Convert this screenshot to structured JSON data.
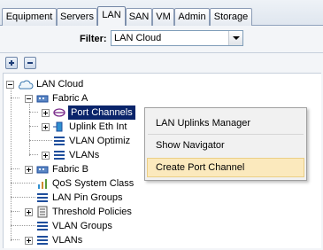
{
  "tabs": [
    {
      "label": "Equipment",
      "active": false
    },
    {
      "label": "Servers",
      "active": false
    },
    {
      "label": "LAN",
      "active": true
    },
    {
      "label": "SAN",
      "active": false
    },
    {
      "label": "VM",
      "active": false
    },
    {
      "label": "Admin",
      "active": false
    },
    {
      "label": "Storage",
      "active": false
    }
  ],
  "filter": {
    "label": "Filter:",
    "value": "LAN Cloud"
  },
  "toolbar": {
    "expand_icon": "plus-icon",
    "collapse_icon": "minus-icon"
  },
  "tree": {
    "root": "LAN Cloud",
    "fabric_a": "Fabric A",
    "port_channels": "Port Channels",
    "uplink_eth": "Uplink Eth Int",
    "vlan_optimization": "VLAN Optimiz",
    "vlans_a": "VLANs",
    "fabric_b": "Fabric B",
    "qos": "QoS System Class",
    "pin_groups": "LAN Pin Groups",
    "threshold": "Threshold Policies",
    "vlan_groups": "VLAN Groups",
    "vlans": "VLANs"
  },
  "context_menu": {
    "items": [
      "LAN Uplinks Manager",
      "Show Navigator",
      "Create Port Channel"
    ],
    "highlighted": "Create Port Channel"
  },
  "colors": {
    "selection": "#0a246a",
    "menu_highlight": "#fbe9bd",
    "panel_bg": "#f3f5f8",
    "icon_blue": "#1f4e9c"
  }
}
